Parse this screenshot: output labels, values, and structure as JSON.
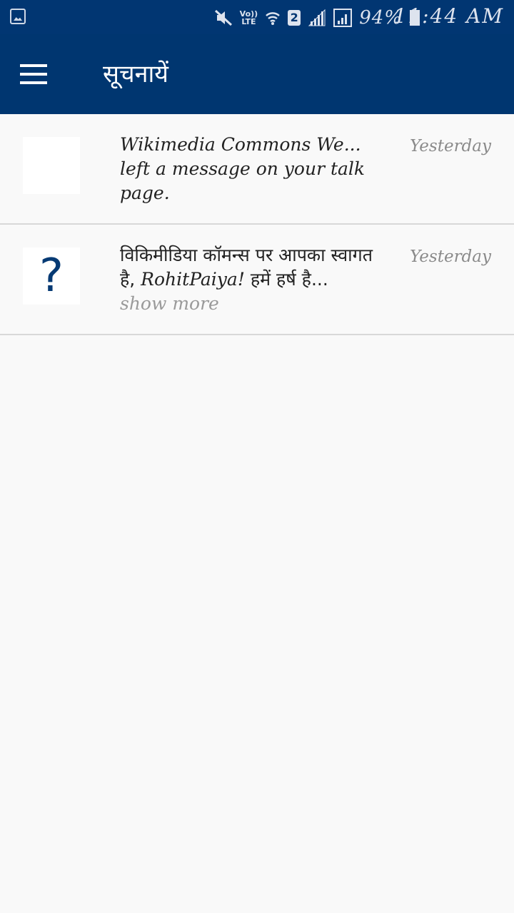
{
  "status_bar": {
    "volte_top": "Vo))",
    "volte_bottom": "LTE",
    "sim_slot": "2",
    "battery_pct": "94%",
    "time": "11:44 AM"
  },
  "app_bar": {
    "title": "सूचनायें",
    "menu_icon": "hamburger-menu-icon"
  },
  "notifications": [
    {
      "text": "Wikimedia Commons We... left a message on your talk page.",
      "time": "Yesterday",
      "thumb_icon": "blank"
    },
    {
      "text_hi_1": "विकिमीडिया कॉमन्स पर आपका स्वागत है, ",
      "text_name": "RohitPaiya!",
      "text_hi_2": " हमें हर्ष है...",
      "show_more": "show more",
      "time": "Yesterday",
      "thumb_icon": "question-mark-icon"
    }
  ],
  "colors": {
    "status_bar": "#013672",
    "app_bar": "#003670",
    "background": "#f9f9f9",
    "divider": "#d8d8d8"
  }
}
